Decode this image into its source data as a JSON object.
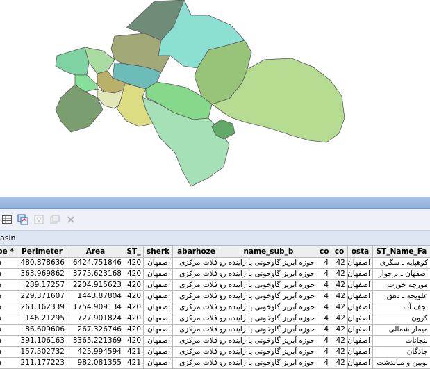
{
  "panel": {
    "tab_label": "asin",
    "toolbar": [
      {
        "name": "table-options-icon",
        "enabled": true
      },
      {
        "name": "related-tables-icon",
        "enabled": true
      },
      {
        "name": "select-by-attributes-icon",
        "enabled": false
      },
      {
        "name": "switch-selection-icon",
        "enabled": false
      },
      {
        "name": "delete-selected-icon",
        "enabled": false
      }
    ]
  },
  "table": {
    "columns": [
      "pe *",
      "Perimeter",
      "Area",
      "ST_",
      "sherk",
      "abarhoze",
      "name_sub_b",
      "co",
      "co",
      "osta",
      "ST_Name_Fa"
    ],
    "rows": [
      [
        "n",
        "480.878636",
        "6424.751846",
        "420",
        "اصفهان",
        "فلات مرکزی",
        "حوزه آبريز گاوخونی يا زاينده رود",
        "4",
        "42",
        "اصفهان",
        "کوهپايه ـ سگزی"
      ],
      [
        "n",
        "363.969862",
        "3775.623168",
        "420",
        "اصفهان",
        "فلات مرکزی",
        "حوزه آبريز گاوخونی يا زاينده رود",
        "4",
        "42",
        "اصفهان",
        "اصفهان ـ برخوار"
      ],
      [
        "n",
        "289.17257",
        "2204.915623",
        "420",
        "اصفهان",
        "فلات مرکزی",
        "حوزه آبريز گاوخونی يا زاينده رود",
        "4",
        "42",
        "اصفهان",
        "مورچه خورت"
      ],
      [
        "n",
        "229.371607",
        "1443.87804",
        "420",
        "اصفهان",
        "فلات مرکزی",
        "حوزه آبريز گاوخونی يا زاينده رود",
        "4",
        "42",
        "اصفهان",
        "علويجه ـ دهق"
      ],
      [
        "n",
        "261.162339",
        "1754.909134",
        "420",
        "اصفهان",
        "فلات مرکزی",
        "حوزه آبريز گاوخونی يا زاينده رود",
        "4",
        "42",
        "اصفهان",
        "نجف آباد"
      ],
      [
        "n",
        "146.21295",
        "727.901824",
        "420",
        "اصفهان",
        "فلات مرکزی",
        "حوزه آبريز گاوخونی يا زاينده رود",
        "4",
        "42",
        "اصفهان",
        "کرون"
      ],
      [
        "n",
        "86.609606",
        "267.326746",
        "420",
        "اصفهان",
        "فلات مرکزی",
        "حوزه آبريز گاوخونی يا زاينده رود",
        "4",
        "42",
        "اصفهان",
        "ميمار شمالی"
      ],
      [
        "n",
        "391.106163",
        "3365.221369",
        "420",
        "اصفهان",
        "فلات مرکزی",
        "حوزه آبريز گاوخونی يا زاينده رود",
        "4",
        "42",
        "اصفهان",
        "لنجانات"
      ],
      [
        "n",
        "157.502732",
        "425.994594",
        "421",
        "اصفهان",
        "فلات مرکزی",
        "حوزه آبريز گاوخونی يا زاينده رود",
        "4",
        "42",
        "اصفهان",
        "چادگان"
      ],
      [
        "n",
        "211.177223",
        "982.081355",
        "421",
        "اصفهان",
        "فلات مرکزی",
        "حوزه آبريز گاوخونی يا زاينده رود",
        "4",
        "42",
        "اصفهان",
        "بويين و مياندشت"
      ]
    ]
  },
  "map": {
    "polygons": [
      {
        "name": "region-northwest-gray",
        "color": "#6e8c77"
      },
      {
        "name": "region-north-cyan",
        "color": "#8ce0d2"
      },
      {
        "name": "region-center-olive",
        "color": "#a3a877"
      },
      {
        "name": "region-west-green",
        "color": "#7fd3a3"
      },
      {
        "name": "region-west-light",
        "color": "#a8dca0"
      },
      {
        "name": "region-northeast-green",
        "color": "#98c47a"
      },
      {
        "name": "region-center-teal",
        "color": "#6cbcb9"
      },
      {
        "name": "region-center-khaki",
        "color": "#b9b16a"
      },
      {
        "name": "region-west-bright",
        "color": "#86e09c"
      },
      {
        "name": "region-southwest-dark",
        "color": "#7a9e6f"
      },
      {
        "name": "region-cream",
        "color": "#e3e6b8"
      },
      {
        "name": "region-yellow",
        "color": "#dcdc82"
      },
      {
        "name": "region-green-mid",
        "color": "#86d98a"
      },
      {
        "name": "region-east-large",
        "color": "#b5dc90"
      },
      {
        "name": "region-south-mint",
        "color": "#a6e0b6"
      },
      {
        "name": "region-small-dark",
        "color": "#62a866"
      }
    ]
  }
}
